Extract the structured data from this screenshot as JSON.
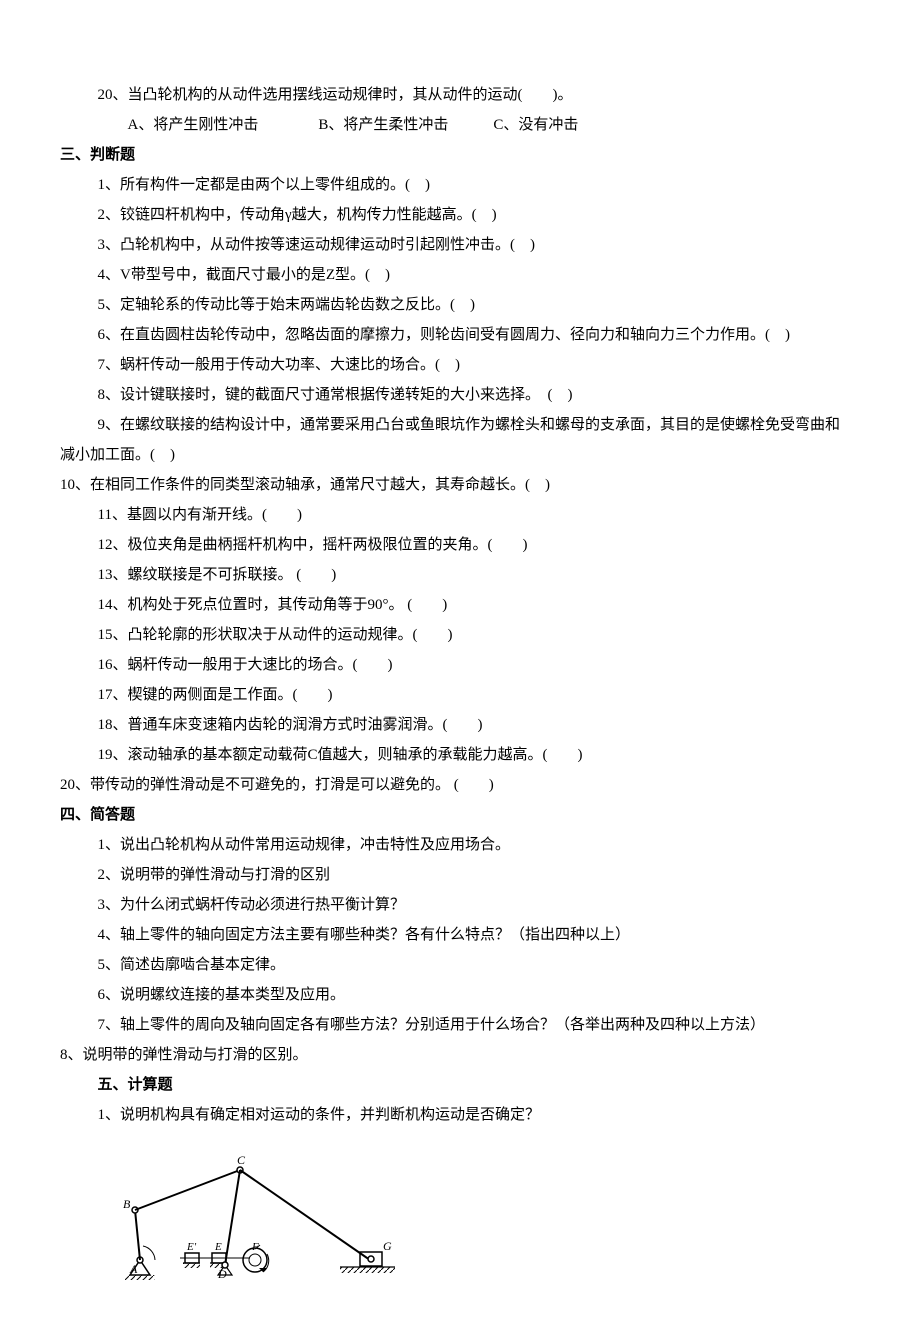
{
  "q20": {
    "text": "20、当凸轮机构的从动件选用摆线运动规律时，其从动件的运动(　　)。",
    "opts": "A、将产生刚性冲击　　　　B、将产生柔性冲击　　　C、没有冲击"
  },
  "sec3": {
    "heading": "三、判断题",
    "items": [
      "1、所有构件一定都是由两个以上零件组成的。(　)",
      "2、铰链四杆机构中，传动角γ越大，机构传力性能越高。(　)",
      "3、凸轮机构中，从动件按等速运动规律运动时引起刚性冲击。(　)",
      "4、V带型号中，截面尺寸最小的是Z型。(　)",
      "5、定轴轮系的传动比等于始末两端齿轮齿数之反比。(　)",
      "6、在直齿圆柱齿轮传动中，忽略齿面的摩擦力，则轮齿间受有圆周力、径向力和轴向力三个力作用。(　)",
      "7、蜗杆传动一般用于传动大功率、大速比的场合。(　)",
      "8、设计键联接时，键的截面尺寸通常根据传递转矩的大小来选择。　(　)"
    ],
    "item9_a": "9、在螺纹联接的结构设计中，通常要采用凸台或鱼眼坑作为螺栓头和螺母的支承面，其目的是使螺栓免受弯曲和",
    "item9_b": "减小加工面。(　)",
    "item10": "10、在相同工作条件的同类型滚动轴承，通常尺寸越大，其寿命越长。(　)",
    "items2": [
      "11、基圆以内有渐开线。(　　)",
      "12、极位夹角是曲柄摇杆机构中，摇杆两极限位置的夹角。(　　)",
      "13、螺纹联接是不可拆联接。 (　　)",
      "14、机构处于死点位置时，其传动角等于90°。 (　　)",
      "15、凸轮轮廓的形状取决于从动件的运动规律。(　　)",
      "16、蜗杆传动一般用于大速比的场合。(　　)",
      "17、楔键的两侧面是工作面。(　　)",
      "18、普通车床变速箱内齿轮的润滑方式时油雾润滑。(　　)",
      "19、滚动轴承的基本额定动载荷C值越大，则轴承的承载能力越高。(　　)"
    ],
    "item20b": "20、带传动的弹性滑动是不可避免的，打滑是可以避免的。 (　　)"
  },
  "sec4": {
    "heading": "四、简答题",
    "items": [
      "1、说出凸轮机构从动件常用运动规律，冲击特性及应用场合。",
      "2、说明带的弹性滑动与打滑的区别",
      "3、为什么闭式蜗杆传动必须进行热平衡计算？",
      "4、轴上零件的轴向固定方法主要有哪些种类？各有什么特点？（指出四种以上）",
      "5、简述齿廓啮合基本定律。",
      "6、说明螺纹连接的基本类型及应用。",
      "7、轴上零件的周向及轴向固定各有哪些方法？分别适用于什么场合？（各举出两种及四种以上方法）"
    ],
    "item8": "8、说明带的弹性滑动与打滑的区别。"
  },
  "sec5": {
    "heading": "五、计算题",
    "item1": "1、说明机构具有确定相对运动的条件，并判断机构运动是否确定？"
  },
  "figure_labels": {
    "A": "A",
    "B": "B",
    "C": "C",
    "D": "D",
    "E": "E",
    "Ep": "E'",
    "F": "F",
    "G": "G"
  }
}
